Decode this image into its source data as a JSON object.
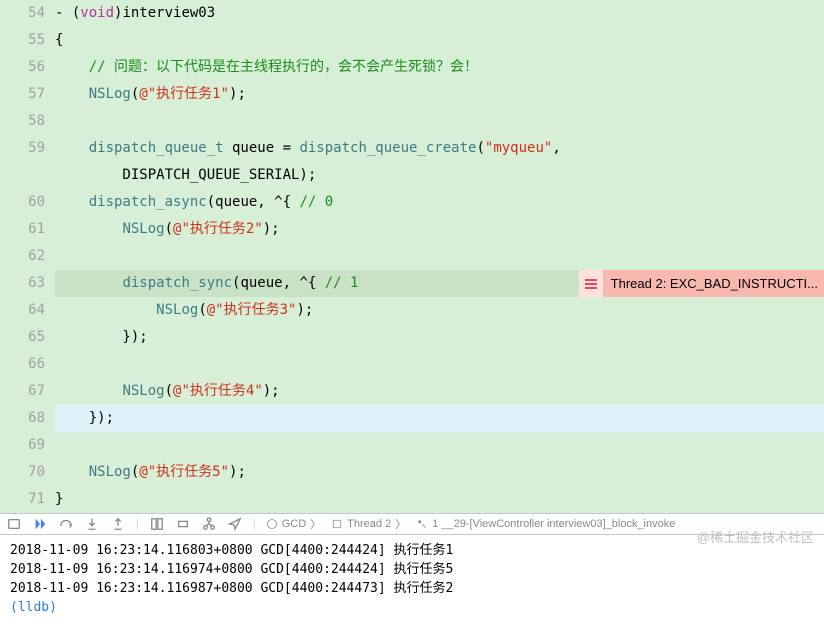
{
  "lines": [
    {
      "num": 54,
      "cls": "",
      "html": "- (<span class='kw'>void</span>)interview03"
    },
    {
      "num": 55,
      "cls": "",
      "html": "{"
    },
    {
      "num": 56,
      "cls": "",
      "html": "    <span class='cmt'>// 问题：以下代码是在主线程执行的，会不会产生死锁？会！</span>"
    },
    {
      "num": 57,
      "cls": "",
      "html": "    <span class='fn'>NSLog</span>(<span class='str'>@\"执行任务1\"</span>);"
    },
    {
      "num": 58,
      "cls": "",
      "html": ""
    },
    {
      "num": 59,
      "cls": "",
      "html": "    <span class='fn'>dispatch_queue_t</span> queue = <span class='fn'>dispatch_queue_create</span>(<span class='str'>\"myqueu\"</span>,"
    },
    {
      "num": "",
      "cls": "",
      "html": "        DISPATCH_QUEUE_SERIAL);"
    },
    {
      "num": 60,
      "cls": "",
      "html": "    <span class='fn'>dispatch_async</span>(queue, ^{ <span class='cmt'>// 0</span>"
    },
    {
      "num": 61,
      "cls": "",
      "html": "        <span class='fn'>NSLog</span>(<span class='str'>@\"执行任务2\"</span>);"
    },
    {
      "num": 62,
      "cls": "",
      "html": ""
    },
    {
      "num": 63,
      "cls": "hl-sel",
      "html": "        <span class='fn'>dispatch_sync</span>(queue, ^{ <span class='cmt'>// 1</span>",
      "err": true
    },
    {
      "num": 64,
      "cls": "",
      "html": "            <span class='fn'>NSLog</span>(<span class='str'>@\"执行任务3\"</span>);"
    },
    {
      "num": 65,
      "cls": "",
      "html": "        });"
    },
    {
      "num": 66,
      "cls": "",
      "html": ""
    },
    {
      "num": 67,
      "cls": "",
      "html": "        <span class='fn'>NSLog</span>(<span class='str'>@\"执行任务4\"</span>);"
    },
    {
      "num": 68,
      "cls": "hl-cur",
      "html": "    });"
    },
    {
      "num": 69,
      "cls": "",
      "html": ""
    },
    {
      "num": 70,
      "cls": "",
      "html": "    <span class='fn'>NSLog</span>(<span class='str'>@\"执行任务5\"</span>);"
    },
    {
      "num": 71,
      "cls": "",
      "html": "}"
    }
  ],
  "error_text": "Thread 2: EXC_BAD_INSTRUCTI...",
  "crumbs": {
    "gcd": "GCD",
    "thread": "Thread 2",
    "frame": "1 __29-[ViewController interview03]_block_invoke"
  },
  "console_lines": [
    "2018-11-09 16:23:14.116803+0800 GCD[4400:244424] 执行任务1",
    "2018-11-09 16:23:14.116974+0800 GCD[4400:244424] 执行任务5",
    "2018-11-09 16:23:14.116987+0800 GCD[4400:244473] 执行任务2"
  ],
  "lldb_prompt": "(lldb)",
  "watermark": "@稀土掘金技术社区"
}
